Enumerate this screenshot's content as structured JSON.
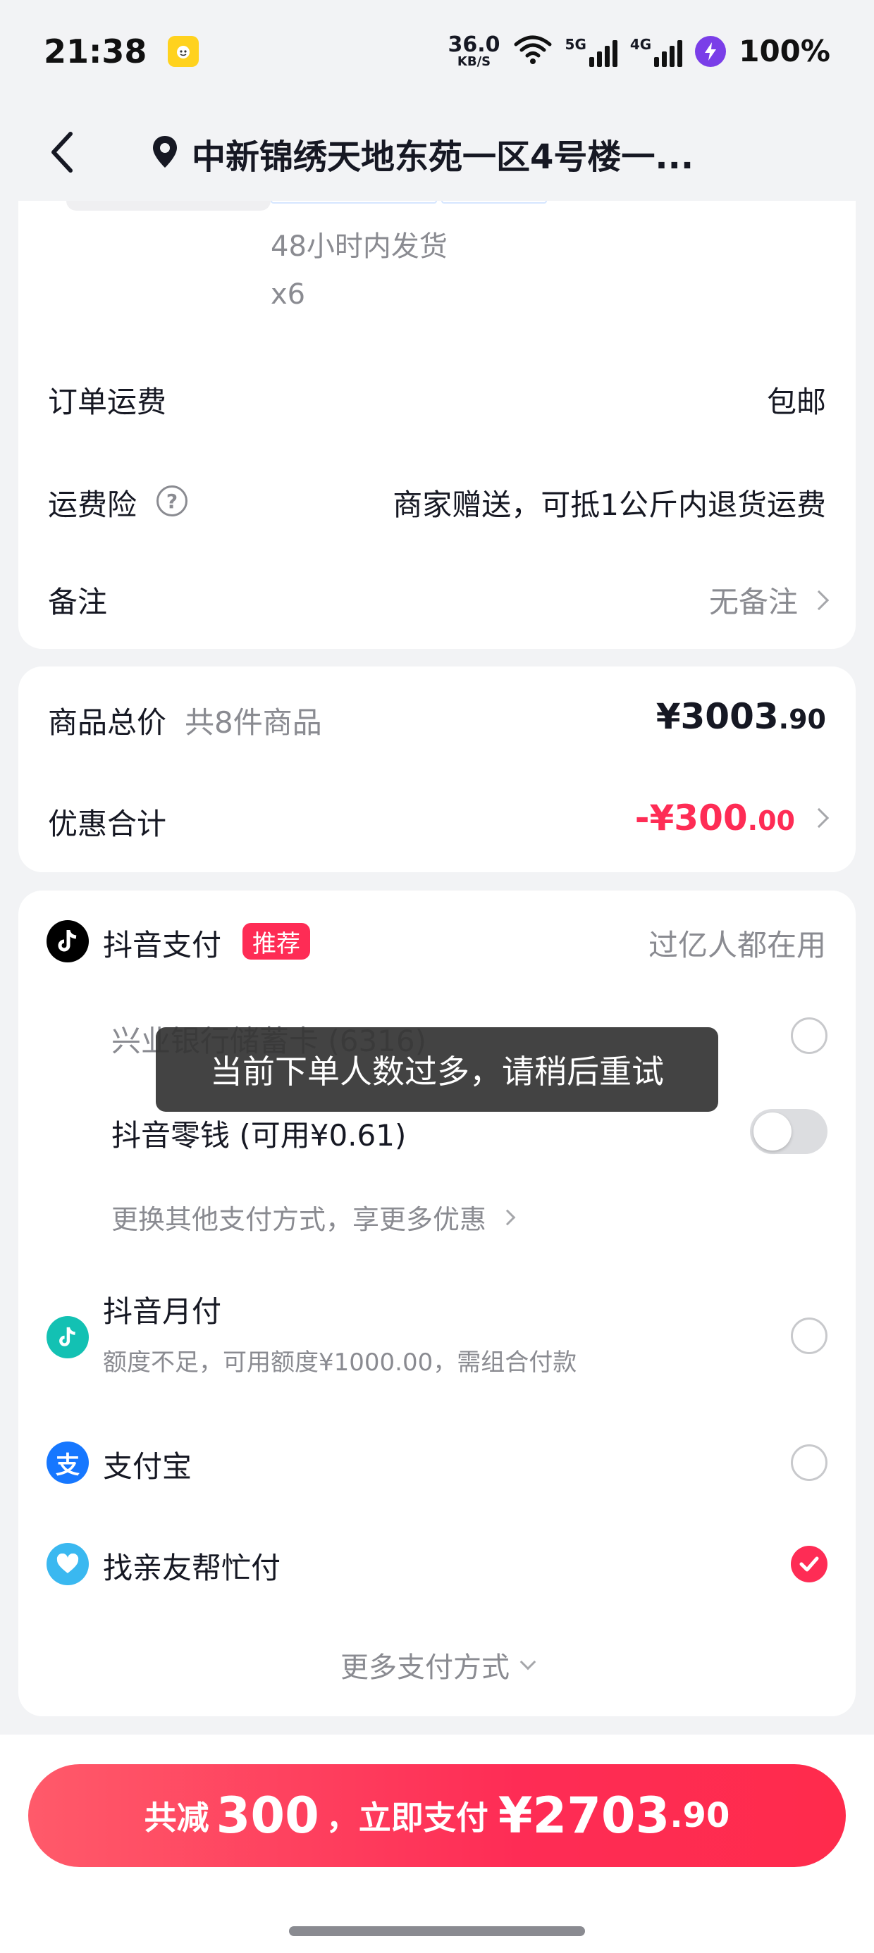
{
  "status_bar": {
    "time": "21:38",
    "app_icon": "meituan-icon",
    "net_speed_value": "36.0",
    "net_speed_unit": "KB/S",
    "signal_1_label": "5G",
    "signal_2_label": "4G",
    "battery_icon": "lightning-icon",
    "battery": "100%"
  },
  "header": {
    "address": "中新锦绣天地东苑一区4号楼一..."
  },
  "product": {
    "shipping_time": "48小时内发货",
    "quantity": "x6"
  },
  "order_info": {
    "freight_label": "订单运费",
    "freight_value": "包邮",
    "insurance_label": "运费险",
    "insurance_help": "?",
    "insurance_value": "商家赠送，可抵1公斤内退货运费",
    "remark_label": "备注",
    "remark_value": "无备注"
  },
  "totals": {
    "goods_label": "商品总价",
    "goods_count": "共8件商品",
    "goods_price_main": "¥3003",
    "goods_price_decimal": ".90",
    "discount_label": "优惠合计",
    "discount_main": "-¥300",
    "discount_decimal": ".00"
  },
  "payment": {
    "douyin_pay_label": "抖音支付",
    "recommend_badge": "推荐",
    "douyin_pay_note": "过亿人都在用",
    "bank_card_label": "兴业银行储蓄卡 (6316)",
    "wallet_label": "抖音零钱 (可用¥0.61)",
    "switch_more_label": "更换其他支付方式，享更多优惠",
    "monthly_label": "抖音月付",
    "monthly_note": "额度不足，可用额度¥1000.00，需组合付款",
    "alipay_label": "支付宝",
    "alipay_glyph": "支",
    "friend_pay_label": "找亲友帮忙付",
    "more_methods_label": "更多支付方式",
    "selected": "找亲友帮忙付"
  },
  "toast": {
    "message": "当前下单人数过多，请稍后重试"
  },
  "bottom": {
    "reduce_prefix": "共减",
    "reduce_amount": "300",
    "pay_prefix": "，立即支付",
    "pay_main": "¥2703",
    "pay_decimal": ".90"
  },
  "colors": {
    "accent": "#fe2c55",
    "page_bg": "#f2f3f5",
    "text": "#161823",
    "muted": "#8a8b91"
  }
}
